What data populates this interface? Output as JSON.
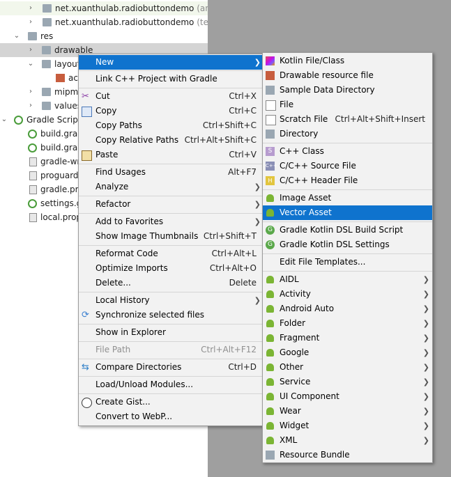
{
  "tree": {
    "rows": [
      {
        "label": "net.xuanthulab.radiobuttondemo",
        "suffix": " (androidTest)",
        "arrow": "›"
      },
      {
        "label": "net.xuanthulab.radiobuttondemo",
        "suffix": " (test)",
        "arrow": "›"
      },
      {
        "label": "res",
        "suffix": "",
        "arrow": "⌄"
      },
      {
        "label": "drawable",
        "suffix": "",
        "arrow": "›"
      },
      {
        "label": "layout",
        "suffix": "",
        "arrow": "⌄"
      },
      {
        "label": "act",
        "suffix": "",
        "arrow": ""
      },
      {
        "label": "mipma",
        "suffix": "",
        "arrow": "›"
      },
      {
        "label": "values",
        "suffix": "",
        "arrow": "›"
      },
      {
        "label": "Gradle Scripts",
        "suffix": "",
        "arrow": "⌄"
      },
      {
        "label": "build.grad",
        "suffix": "",
        "arrow": ""
      },
      {
        "label": "build.grad",
        "suffix": "",
        "arrow": ""
      },
      {
        "label": "gradle-wra",
        "suffix": "",
        "arrow": ""
      },
      {
        "label": "proguard-",
        "suffix": "",
        "arrow": ""
      },
      {
        "label": "gradle.pro",
        "suffix": "",
        "arrow": ""
      },
      {
        "label": "settings.gr",
        "suffix": "",
        "arrow": ""
      },
      {
        "label": "local.prop",
        "suffix": "",
        "arrow": ""
      }
    ]
  },
  "context_menu": {
    "items": [
      {
        "label": "New",
        "shortcut": "",
        "submenu": true
      },
      {
        "label": "Link C++ Project with Gradle",
        "shortcut": ""
      },
      {
        "label": "Cut",
        "shortcut": "Ctrl+X"
      },
      {
        "label": "Copy",
        "shortcut": "Ctrl+C"
      },
      {
        "label": "Copy Paths",
        "shortcut": "Ctrl+Shift+C"
      },
      {
        "label": "Copy Relative Paths",
        "shortcut": "Ctrl+Alt+Shift+C"
      },
      {
        "label": "Paste",
        "shortcut": "Ctrl+V"
      },
      {
        "label": "Find Usages",
        "shortcut": "Alt+F7"
      },
      {
        "label": "Analyze",
        "shortcut": "",
        "submenu": true
      },
      {
        "label": "Refactor",
        "shortcut": "",
        "submenu": true
      },
      {
        "label": "Add to Favorites",
        "shortcut": "",
        "submenu": true
      },
      {
        "label": "Show Image Thumbnails",
        "shortcut": "Ctrl+Shift+T"
      },
      {
        "label": "Reformat Code",
        "shortcut": "Ctrl+Alt+L"
      },
      {
        "label": "Optimize Imports",
        "shortcut": "Ctrl+Alt+O"
      },
      {
        "label": "Delete...",
        "shortcut": "Delete"
      },
      {
        "label": "Local History",
        "shortcut": "",
        "submenu": true
      },
      {
        "label": "Synchronize selected files",
        "shortcut": ""
      },
      {
        "label": "Show in Explorer",
        "shortcut": ""
      },
      {
        "label": "File Path",
        "shortcut": "Ctrl+Alt+F12"
      },
      {
        "label": "Compare Directories",
        "shortcut": "Ctrl+D"
      },
      {
        "label": "Load/Unload Modules...",
        "shortcut": ""
      },
      {
        "label": "Create Gist...",
        "shortcut": ""
      },
      {
        "label": "Convert to WebP...",
        "shortcut": ""
      }
    ]
  },
  "new_submenu": {
    "items": [
      {
        "label": "Kotlin File/Class",
        "shortcut": ""
      },
      {
        "label": "Drawable resource file",
        "shortcut": ""
      },
      {
        "label": "Sample Data Directory",
        "shortcut": ""
      },
      {
        "label": "File",
        "shortcut": ""
      },
      {
        "label": "Scratch File",
        "shortcut": "Ctrl+Alt+Shift+Insert"
      },
      {
        "label": "Directory",
        "shortcut": ""
      },
      {
        "label": "C++ Class",
        "shortcut": ""
      },
      {
        "label": "C/C++ Source File",
        "shortcut": ""
      },
      {
        "label": "C/C++ Header File",
        "shortcut": ""
      },
      {
        "label": "Image Asset",
        "shortcut": ""
      },
      {
        "label": "Vector Asset",
        "shortcut": ""
      },
      {
        "label": "Gradle Kotlin DSL Build Script",
        "shortcut": ""
      },
      {
        "label": "Gradle Kotlin DSL Settings",
        "shortcut": ""
      },
      {
        "label": "Edit File Templates...",
        "shortcut": ""
      },
      {
        "label": "AIDL",
        "shortcut": ""
      },
      {
        "label": "Activity",
        "shortcut": ""
      },
      {
        "label": "Android Auto",
        "shortcut": ""
      },
      {
        "label": "Folder",
        "shortcut": ""
      },
      {
        "label": "Fragment",
        "shortcut": ""
      },
      {
        "label": "Google",
        "shortcut": ""
      },
      {
        "label": "Other",
        "shortcut": ""
      },
      {
        "label": "Service",
        "shortcut": ""
      },
      {
        "label": "UI Component",
        "shortcut": ""
      },
      {
        "label": "Wear",
        "shortcut": ""
      },
      {
        "label": "Widget",
        "shortcut": ""
      },
      {
        "label": "XML",
        "shortcut": ""
      },
      {
        "label": "Resource Bundle",
        "shortcut": ""
      }
    ]
  },
  "colors": {
    "highlight": "#0f73ce",
    "menu_bg": "#f2f2f2",
    "android_green": "#7bb534"
  }
}
